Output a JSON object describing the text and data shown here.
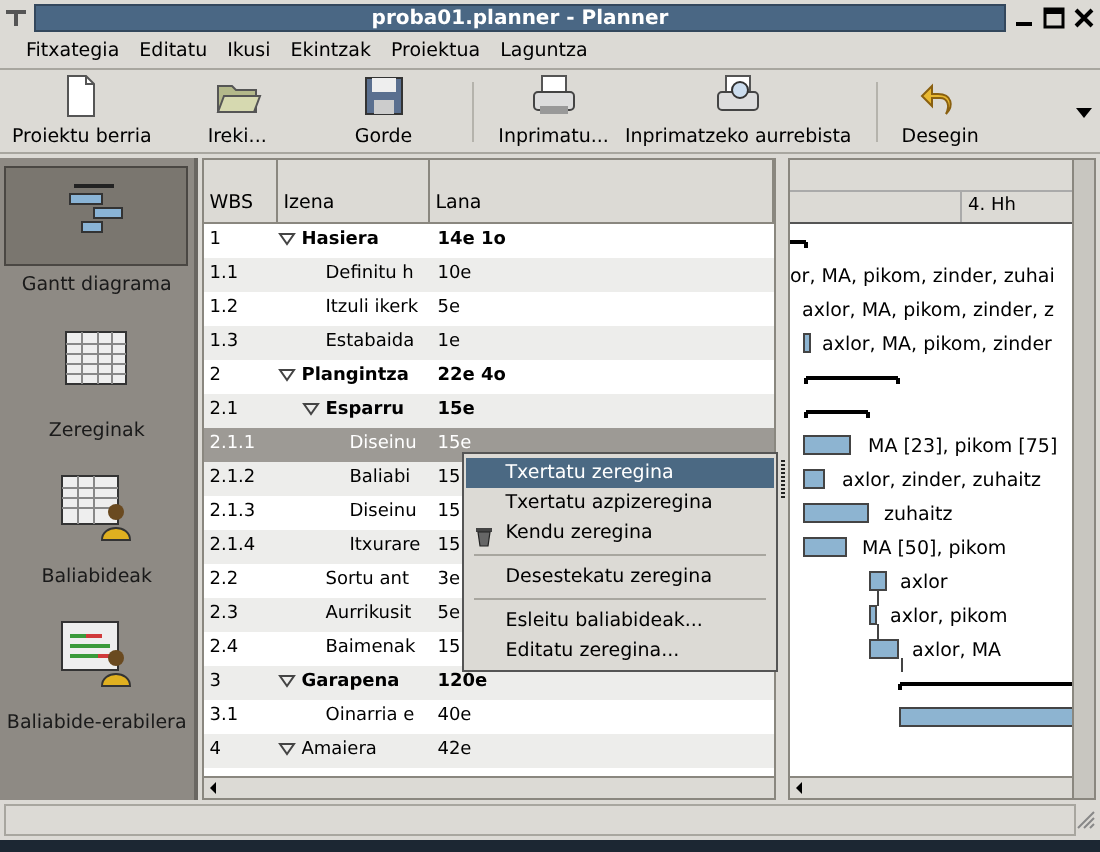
{
  "window": {
    "title": "proba01.planner - Planner"
  },
  "menu": [
    "Fitxategia",
    "Editatu",
    "Ikusi",
    "Ekintzak",
    "Proiektua",
    "Laguntza"
  ],
  "toolbar": [
    {
      "kind": "new",
      "label": "Proiektu berria"
    },
    {
      "kind": "open",
      "label": "Ireki..."
    },
    {
      "kind": "save",
      "label": "Gorde"
    },
    {
      "kind": "separator"
    },
    {
      "kind": "print",
      "label": "Inprimatu..."
    },
    {
      "kind": "preview",
      "label": "Inprimatzeko aurrebista"
    },
    {
      "kind": "separator"
    },
    {
      "kind": "undo",
      "label": "Desegin"
    }
  ],
  "sidebar": {
    "items": [
      {
        "kind": "gantt",
        "label": "Gantt diagrama",
        "selected": true
      },
      {
        "kind": "tasks",
        "label": "Zereginak",
        "selected": false
      },
      {
        "kind": "resources",
        "label": "Baliabideak",
        "selected": false
      },
      {
        "kind": "usage",
        "label": "Baliabide-erabilera",
        "selected": false
      }
    ]
  },
  "table": {
    "columns": [
      "WBS",
      "Izena",
      "Lana"
    ],
    "rows": [
      {
        "wbs": "1",
        "name": "Hasiera",
        "work": "14e 1o",
        "expanded": true,
        "selected": false,
        "children": [
          {
            "wbs": "1.1",
            "name": "Definitu h",
            "work": "10e",
            "selected": false
          },
          {
            "wbs": "1.2",
            "name": "Itzuli ikerk",
            "work": "5e",
            "selected": false
          },
          {
            "wbs": "1.3",
            "name": "Estabaida",
            "work": "1e",
            "selected": false
          }
        ]
      },
      {
        "wbs": "2",
        "name": "Plangintza",
        "work": "22e 4o",
        "expanded": true,
        "selected": false,
        "children": [
          {
            "wbs": "2.1",
            "name": "Esparru",
            "work": "15e",
            "expanded": true,
            "selected": false,
            "children": [
              {
                "wbs": "2.1.1",
                "name": "Diseinu",
                "work": "15e",
                "selected": true
              },
              {
                "wbs": "2.1.2",
                "name": "Baliabi",
                "work": "15",
                "selected": false
              },
              {
                "wbs": "2.1.3",
                "name": "Diseinu",
                "work": "15",
                "selected": false
              },
              {
                "wbs": "2.1.4",
                "name": "Itxurare",
                "work": "15",
                "selected": false
              }
            ]
          },
          {
            "wbs": "2.2",
            "name": "Sortu ant",
            "work": "3e",
            "selected": false
          },
          {
            "wbs": "2.3",
            "name": "Aurrikusit",
            "work": "5e",
            "selected": false
          },
          {
            "wbs": "2.4",
            "name": "Baimenak",
            "work": "15",
            "selected": false
          }
        ]
      },
      {
        "wbs": "3",
        "name": "Garapena",
        "work": "120e",
        "expanded": true,
        "selected": false,
        "children": [
          {
            "wbs": "3.1",
            "name": "Oinarria e",
            "work": "40e",
            "selected": false
          }
        ]
      },
      {
        "wbs": "4",
        "name": "Amaiera",
        "work": "42e",
        "expanded": true,
        "selected": false
      }
    ]
  },
  "gantt": {
    "header": "4. Hh",
    "rows": [
      {
        "kind": "summary"
      },
      {
        "kind": "task",
        "label": "or, MA, pikom, zinder, zuhai"
      },
      {
        "kind": "task",
        "label": "axlor, MA, pikom, zinder, z"
      },
      {
        "kind": "task",
        "label": "axlor, MA, pikom, zinder"
      },
      {
        "kind": "summary"
      },
      {
        "kind": "summary"
      },
      {
        "kind": "task",
        "label": "MA [23], pikom [75]"
      },
      {
        "kind": "task",
        "label": "axlor, zinder, zuhaitz"
      },
      {
        "kind": "task",
        "label": "zuhaitz"
      },
      {
        "kind": "task",
        "label": "MA [50], pikom"
      },
      {
        "kind": "task",
        "label": "axlor"
      },
      {
        "kind": "task",
        "label": "axlor, pikom"
      },
      {
        "kind": "task",
        "label": "axlor, MA"
      },
      {
        "kind": "summary"
      },
      {
        "kind": "task"
      }
    ]
  },
  "context_menu": [
    {
      "kind": "item",
      "label": "Txertatu zeregina",
      "selected": true
    },
    {
      "kind": "item",
      "label": "Txertatu azpizeregina",
      "selected": false
    },
    {
      "kind": "delete",
      "label": "Kendu zeregina",
      "selected": false
    },
    {
      "kind": "separator"
    },
    {
      "kind": "item",
      "label": "Desestekatu zeregina",
      "selected": false
    },
    {
      "kind": "separator"
    },
    {
      "kind": "item",
      "label": "Esleitu baliabideak...",
      "selected": false
    },
    {
      "kind": "item",
      "label": "Editatu zeregina...",
      "selected": false
    }
  ]
}
